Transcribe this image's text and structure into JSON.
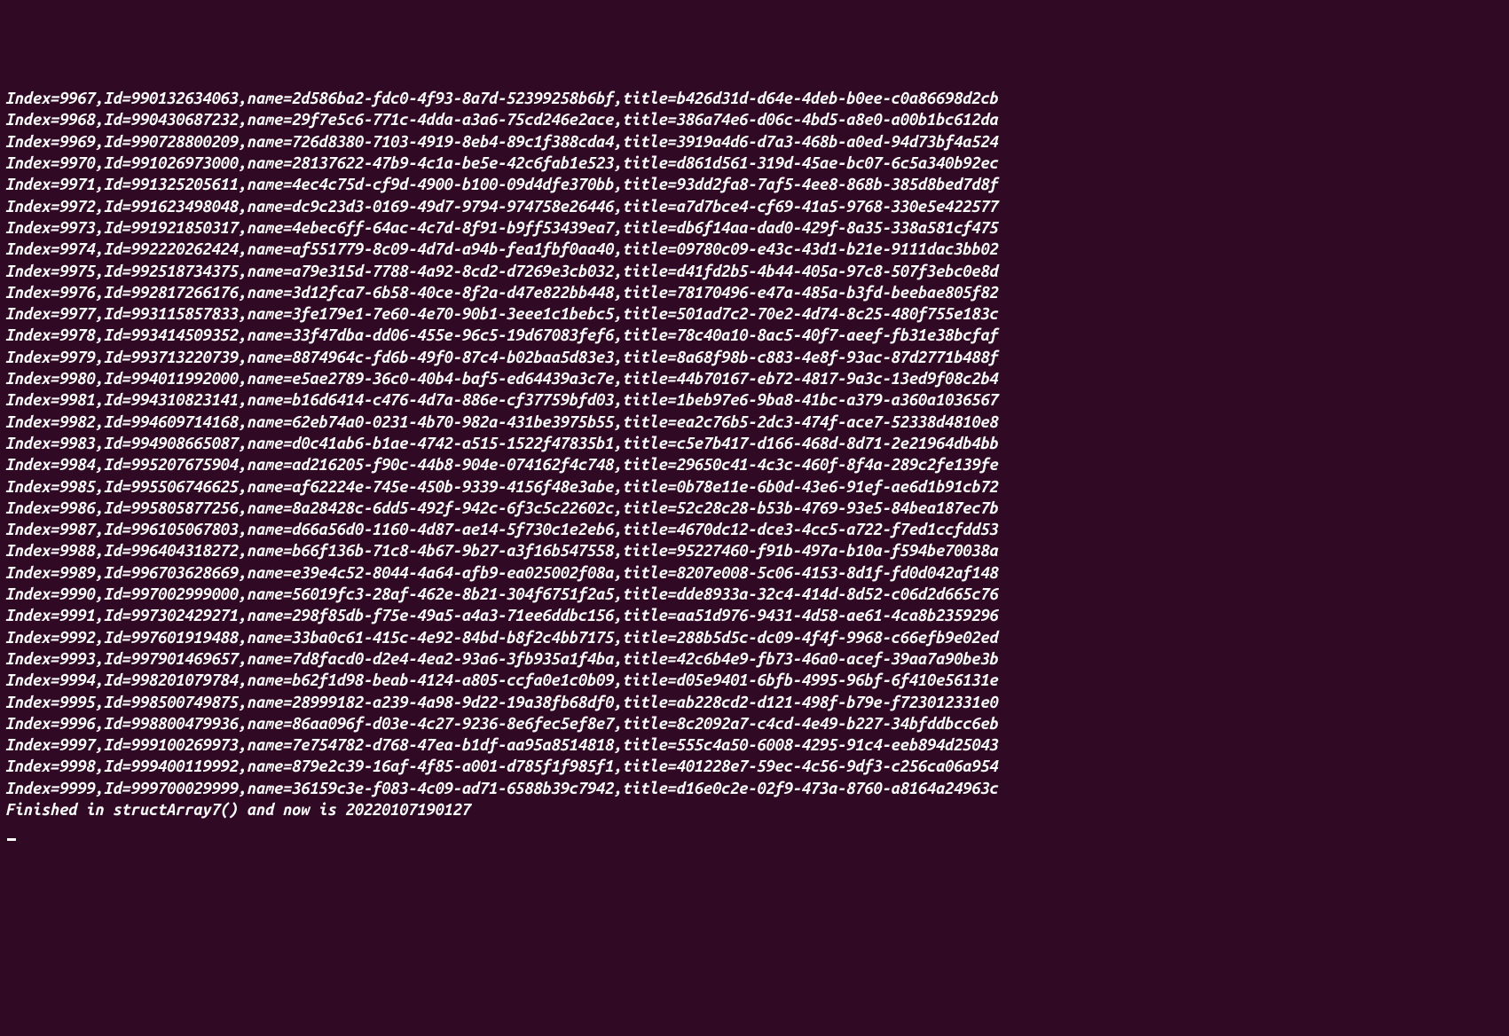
{
  "records": [
    {
      "index": 9967,
      "id": "990132634063",
      "name": "2d586ba2-fdc0-4f93-8a7d-52399258b6bf",
      "title": "b426d31d-d64e-4deb-b0ee-c0a86698d2cb"
    },
    {
      "index": 9968,
      "id": "990430687232",
      "name": "29f7e5c6-771c-4dda-a3a6-75cd246e2ace",
      "title": "386a74e6-d06c-4bd5-a8e0-a00b1bc612da"
    },
    {
      "index": 9969,
      "id": "990728800209",
      "name": "726d8380-7103-4919-8eb4-89c1f388cda4",
      "title": "3919a4d6-d7a3-468b-a0ed-94d73bf4a524"
    },
    {
      "index": 9970,
      "id": "991026973000",
      "name": "28137622-47b9-4c1a-be5e-42c6fab1e523",
      "title": "d861d561-319d-45ae-bc07-6c5a340b92ec"
    },
    {
      "index": 9971,
      "id": "991325205611",
      "name": "4ec4c75d-cf9d-4900-b100-09d4dfe370bb",
      "title": "93dd2fa8-7af5-4ee8-868b-385d8bed7d8f"
    },
    {
      "index": 9972,
      "id": "991623498048",
      "name": "dc9c23d3-0169-49d7-9794-974758e26446",
      "title": "a7d7bce4-cf69-41a5-9768-330e5e422577"
    },
    {
      "index": 9973,
      "id": "991921850317",
      "name": "4ebec6ff-64ac-4c7d-8f91-b9ff53439ea7",
      "title": "db6f14aa-dad0-429f-8a35-338a581cf475"
    },
    {
      "index": 9974,
      "id": "992220262424",
      "name": "af551779-8c09-4d7d-a94b-fea1fbf0aa40",
      "title": "09780c09-e43c-43d1-b21e-9111dac3bb02"
    },
    {
      "index": 9975,
      "id": "992518734375",
      "name": "a79e315d-7788-4a92-8cd2-d7269e3cb032",
      "title": "d41fd2b5-4b44-405a-97c8-507f3ebc0e8d"
    },
    {
      "index": 9976,
      "id": "992817266176",
      "name": "3d12fca7-6b58-40ce-8f2a-d47e822bb448",
      "title": "78170496-e47a-485a-b3fd-beebae805f82"
    },
    {
      "index": 9977,
      "id": "993115857833",
      "name": "3fe179e1-7e60-4e70-90b1-3eee1c1bebc5",
      "title": "501ad7c2-70e2-4d74-8c25-480f755e183c"
    },
    {
      "index": 9978,
      "id": "993414509352",
      "name": "33f47dba-dd06-455e-96c5-19d67083fef6",
      "title": "78c40a10-8ac5-40f7-aeef-fb31e38bcfaf"
    },
    {
      "index": 9979,
      "id": "993713220739",
      "name": "8874964c-fd6b-49f0-87c4-b02baa5d83e3",
      "title": "8a68f98b-c883-4e8f-93ac-87d2771b488f"
    },
    {
      "index": 9980,
      "id": "994011992000",
      "name": "e5ae2789-36c0-40b4-baf5-ed64439a3c7e",
      "title": "44b70167-eb72-4817-9a3c-13ed9f08c2b4"
    },
    {
      "index": 9981,
      "id": "994310823141",
      "name": "b16d6414-c476-4d7a-886e-cf37759bfd03",
      "title": "1beb97e6-9ba8-41bc-a379-a360a1036567"
    },
    {
      "index": 9982,
      "id": "994609714168",
      "name": "62eb74a0-0231-4b70-982a-431be3975b55",
      "title": "ea2c76b5-2dc3-474f-ace7-52338d4810e8"
    },
    {
      "index": 9983,
      "id": "994908665087",
      "name": "d0c41ab6-b1ae-4742-a515-1522f47835b1",
      "title": "c5e7b417-d166-468d-8d71-2e21964db4bb"
    },
    {
      "index": 9984,
      "id": "995207675904",
      "name": "ad216205-f90c-44b8-904e-074162f4c748",
      "title": "29650c41-4c3c-460f-8f4a-289c2fe139fe"
    },
    {
      "index": 9985,
      "id": "995506746625",
      "name": "af62224e-745e-450b-9339-4156f48e3abe",
      "title": "0b78e11e-6b0d-43e6-91ef-ae6d1b91cb72"
    },
    {
      "index": 9986,
      "id": "995805877256",
      "name": "8a28428c-6dd5-492f-942c-6f3c5c22602c",
      "title": "52c28c28-b53b-4769-93e5-84bea187ec7b"
    },
    {
      "index": 9987,
      "id": "996105067803",
      "name": "d66a56d0-1160-4d87-ae14-5f730c1e2eb6",
      "title": "4670dc12-dce3-4cc5-a722-f7ed1ccfdd53"
    },
    {
      "index": 9988,
      "id": "996404318272",
      "name": "b66f136b-71c8-4b67-9b27-a3f16b547558",
      "title": "95227460-f91b-497a-b10a-f594be70038a"
    },
    {
      "index": 9989,
      "id": "996703628669",
      "name": "e39e4c52-8044-4a64-afb9-ea025002f08a",
      "title": "8207e008-5c06-4153-8d1f-fd0d042af148"
    },
    {
      "index": 9990,
      "id": "997002999000",
      "name": "56019fc3-28af-462e-8b21-304f6751f2a5",
      "title": "dde8933a-32c4-414d-8d52-c06d2d665c76"
    },
    {
      "index": 9991,
      "id": "997302429271",
      "name": "298f85db-f75e-49a5-a4a3-71ee6ddbc156",
      "title": "aa51d976-9431-4d58-ae61-4ca8b2359296"
    },
    {
      "index": 9992,
      "id": "997601919488",
      "name": "33ba0c61-415c-4e92-84bd-b8f2c4bb7175",
      "title": "288b5d5c-dc09-4f4f-9968-c66efb9e02ed"
    },
    {
      "index": 9993,
      "id": "997901469657",
      "name": "7d8facd0-d2e4-4ea2-93a6-3fb935a1f4ba",
      "title": "42c6b4e9-fb73-46a0-acef-39aa7a90be3b"
    },
    {
      "index": 9994,
      "id": "998201079784",
      "name": "b62f1d98-beab-4124-a805-ccfa0e1c0b09",
      "title": "d05e9401-6bfb-4995-96bf-6f410e56131e"
    },
    {
      "index": 9995,
      "id": "998500749875",
      "name": "28999182-a239-4a98-9d22-19a38fb68df0",
      "title": "ab228cd2-d121-498f-b79e-f723012331e0"
    },
    {
      "index": 9996,
      "id": "998800479936",
      "name": "86aa096f-d03e-4c27-9236-8e6fec5ef8e7",
      "title": "8c2092a7-c4cd-4e49-b227-34bfddbcc6eb"
    },
    {
      "index": 9997,
      "id": "999100269973",
      "name": "7e754782-d768-47ea-b1df-aa95a8514818",
      "title": "555c4a50-6008-4295-91c4-eeb894d25043"
    },
    {
      "index": 9998,
      "id": "999400119992",
      "name": "879e2c39-16af-4f85-a001-d785f1f985f1",
      "title": "401228e7-59ec-4c56-9df3-c256ca06a954"
    },
    {
      "index": 9999,
      "id": "999700029999",
      "name": "36159c3e-f083-4c09-ad71-6588b39c7942",
      "title": "d16e0c2e-02f9-473a-8760-a8164a24963c"
    }
  ],
  "footer": "Finished in structArray7() and now is 20220107190127"
}
